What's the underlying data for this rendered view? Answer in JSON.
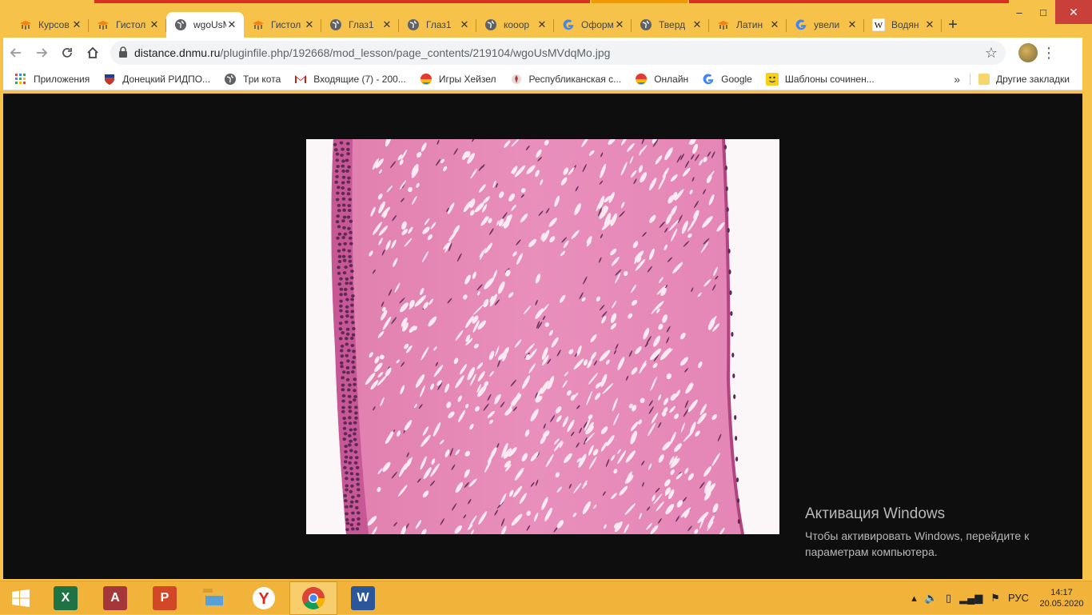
{
  "window": {
    "minimize": "‒",
    "maximize": "□",
    "close": "✕"
  },
  "tabs": [
    {
      "title": "Курсов",
      "icon": "moodle-hat-icon",
      "active": false
    },
    {
      "title": "Гистол",
      "icon": "moodle-hat-icon",
      "active": false
    },
    {
      "title": "wgoUsM",
      "icon": "globe-icon",
      "active": true
    },
    {
      "title": "Гистол",
      "icon": "moodle-hat-icon",
      "active": false
    },
    {
      "title": "Глаз1",
      "icon": "globe-icon",
      "active": false
    },
    {
      "title": "Глаз1",
      "icon": "globe-icon",
      "active": false
    },
    {
      "title": "кооор",
      "icon": "globe-icon",
      "active": false
    },
    {
      "title": "Оформ",
      "icon": "google-g-icon",
      "active": false
    },
    {
      "title": "Тверд",
      "icon": "globe-icon",
      "active": false
    },
    {
      "title": "Латин",
      "icon": "moodle-hat-icon",
      "active": false
    },
    {
      "title": "увели",
      "icon": "google-g-icon",
      "active": false
    },
    {
      "title": "Водян",
      "icon": "wikipedia-icon",
      "active": false
    }
  ],
  "toolbar": {
    "url_host": "distance.dnmu.ru",
    "url_path": "/pluginfile.php/192668/mod_lesson/page_contents/219104/wgoUsMVdqMo.jpg"
  },
  "bookmarks": [
    {
      "label": "Приложения",
      "icon": "apps-grid-icon"
    },
    {
      "label": "Донецкий РИДПО...",
      "icon": "crest-icon"
    },
    {
      "label": "Три кота",
      "icon": "globe-icon"
    },
    {
      "label": "Входящие (7) - 200...",
      "icon": "gmail-icon"
    },
    {
      "label": "Игры Хейзел",
      "icon": "colorful-ball-icon"
    },
    {
      "label": "Республиканская с...",
      "icon": "emblem-icon"
    },
    {
      "label": "Онлайн",
      "icon": "colorful-ball-icon"
    },
    {
      "label": "Google",
      "icon": "google-g-icon"
    },
    {
      "label": "Шаблоны сочинен...",
      "icon": "smiley-icon"
    }
  ],
  "bookmarks_other": "Другие закладки",
  "activation": {
    "title": "Активация Windows",
    "line": "Чтобы активировать Windows, перейдите к параметрам компьютера."
  },
  "taskbar": {
    "apps": [
      {
        "name": "excel",
        "letter": "X",
        "color": "#1f7244"
      },
      {
        "name": "access",
        "letter": "A",
        "color": "#a4373a"
      },
      {
        "name": "powerpoint",
        "letter": "P",
        "color": "#d24726"
      },
      {
        "name": "file-explorer",
        "letter": "",
        "color": "#e8b64a"
      },
      {
        "name": "yandex-browser",
        "letter": "Y",
        "color": "#ffffff"
      },
      {
        "name": "chrome",
        "letter": "",
        "color": "#ffffff"
      },
      {
        "name": "word",
        "letter": "W",
        "color": "#2b579a"
      }
    ],
    "active_app": "chrome",
    "language": "РУС",
    "time": "14:17",
    "date": "20.05.2020"
  }
}
